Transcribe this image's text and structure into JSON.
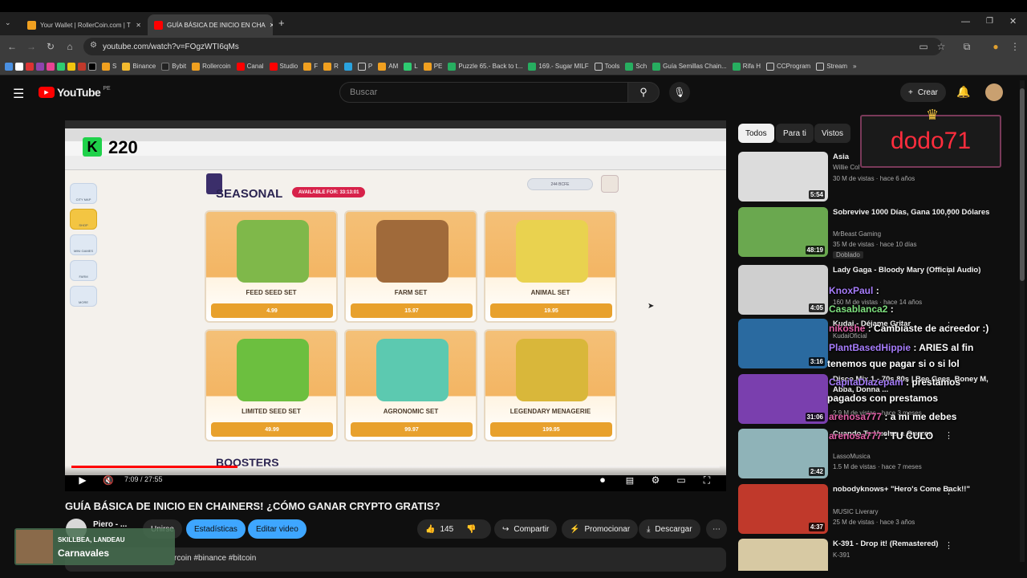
{
  "browser": {
    "tabs": [
      {
        "title": "Your Wallet | RollerCoin.com | T",
        "active": false
      },
      {
        "title": "GUÍA BÁSICA DE INICIO EN CHA",
        "active": true
      }
    ],
    "url": "youtube.com/watch?v=FOgzWTI6qMs",
    "bookmarks": [
      "S",
      "Binance",
      "Bybit",
      "Rollercoin",
      "Canal",
      "Studio",
      "F",
      "R",
      "P",
      "AM",
      "L",
      "PE",
      "Puzzle 65.- Back to t...",
      "169.- Sugar MILF",
      "Tools",
      "Sch",
      "Guía Semillas Chain...",
      "Rifa H",
      "CCProgram",
      "Stream"
    ]
  },
  "youtube": {
    "logo": "YouTube",
    "region": "PE",
    "search_placeholder": "Buscar",
    "create_label": "Crear"
  },
  "video": {
    "title": "GUÍA BÁSICA DE INICIO EN CHAINERS! ¿CÓMO GANAR CRYPTO GRATIS?",
    "time": "7:09 / 27:55",
    "progress": 0.256,
    "overlay_counter": "220",
    "channel": "Piero - ...",
    "subscribe": "Unirse",
    "stats_btn": "Estadísticas",
    "edit_btn": "Editar video",
    "likes": "145",
    "share": "Compartir",
    "promote": "Promocionar",
    "download": "Descargar",
    "description_tags": "rcoin #binance #bitcoin",
    "now_playing_artist": "SKILLBEA, LANDEAU",
    "now_playing_title": "Carnavales"
  },
  "game": {
    "section": "SEASONAL",
    "available": "AVAILABLE FOR: 33:13:01",
    "balance": "244 BCFE",
    "cards": [
      {
        "name": "FEED SEED SET",
        "price": "4.99",
        "color": "#7fb84a"
      },
      {
        "name": "FARM SET",
        "price": "15.97",
        "color": "#a06a3a"
      },
      {
        "name": "ANIMAL SET",
        "price": "19.95",
        "color": "#e9d24f"
      },
      {
        "name": "LIMITED SEED SET",
        "price": "49.99",
        "color": "#6cbf3f"
      },
      {
        "name": "AGRONOMIC SET",
        "price": "99.97",
        "color": "#5cc9b0"
      },
      {
        "name": "LEGENDARY MENAGERIE",
        "price": "199.95",
        "color": "#d9b73a"
      }
    ],
    "boosters": "BOOSTERS",
    "sidebar": [
      "CITY MAP",
      "SHOP",
      "MINI GAMES",
      "FARM",
      "MORE"
    ]
  },
  "sidebar": {
    "chips": [
      "Todos",
      "Para ti",
      "Vistos"
    ],
    "recommendations": [
      {
        "title": "Asia",
        "channel": "Willie Col",
        "meta": "30 M de vistas · hace 6 años",
        "duration": "5:54",
        "color": "#dcdcdc"
      },
      {
        "title": "Sobrevive 1000 Días, Gana 100,000 Dólares",
        "channel": "MrBeast Gaming",
        "meta": "35 M de vistas · hace 10 días",
        "badge": "Doblado",
        "duration": "48:19",
        "color": "#6aa84f"
      },
      {
        "title": "Lady Gaga - Bloody Mary (Official Audio)",
        "channel": "",
        "meta": "160 M de vistas · hace 14 años",
        "duration": "4:05",
        "color": "#cfcfcf"
      },
      {
        "title": "Kudai - Déjame Gritar",
        "channel": "KudaiOficial",
        "meta": "",
        "duration": "3:16",
        "color": "#2a6aa0"
      },
      {
        "title": "Disco Mix 1 - 70s 80s | Bee Gees, Boney M, Abba, Donna ...",
        "channel": "",
        "meta": "2.9 M de vistas · hace 3 meses",
        "duration": "31:06",
        "color": "#7a3fae"
      },
      {
        "title": "Cuando Te Vuelva a Querer",
        "channel": "LassoMusica",
        "meta": "1.5 M de vistas · hace 7 meses",
        "duration": "2:42",
        "color": "#8fb3b8"
      },
      {
        "title": "nobodyknows+ \"Hero's Come Back!!\"",
        "channel": "MUSIC Liverary",
        "meta": "25 M de vistas · hace 3 años",
        "duration": "4:37",
        "color": "#c0392b"
      },
      {
        "title": "K-391 - Drop it! (Remastered)",
        "channel": "K-391",
        "meta": "",
        "duration": "",
        "color": "#d7c9a3"
      }
    ]
  },
  "stream_overlay": {
    "username": "dodo71",
    "chat": [
      {
        "user": "KnoxPaul",
        "msg": ":"
      },
      {
        "user": "Casablanca2",
        "msg": ":"
      },
      {
        "user": "nikoshe",
        "msg": ": Cambiaste de acreedor :)"
      },
      {
        "user": "PlantBasedHippie",
        "msg": ": ARIES al fin"
      },
      {
        "user": "",
        "msg": "tenemos que pagar si o si lol"
      },
      {
        "user": "CapitaDiazepam",
        "msg": ": prestamos"
      },
      {
        "user": "",
        "msg": "pagados con prestamos"
      },
      {
        "user": "arenosa777",
        "msg": ": a mi me debes"
      },
      {
        "user": "arenosa777",
        "msg": ": TU CULO"
      }
    ]
  }
}
